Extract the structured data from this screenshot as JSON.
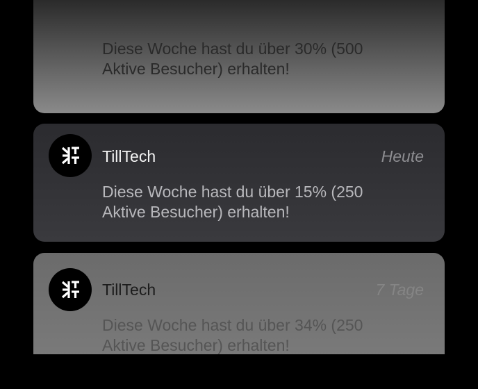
{
  "notifications": [
    {
      "message": "Diese Woche hast du über 30% (500 Aktive Besucher) erhalten!"
    },
    {
      "app": "TillTech",
      "time": "Heute",
      "message": "Diese Woche hast du über 15% (250 Aktive Besucher) erhalten!",
      "icon": "tilltech-logo-icon"
    },
    {
      "app": "TillTech",
      "time": "7 Tage",
      "message": "Diese Woche hast du über 34% (250 Aktive Besucher) erhalten!",
      "icon": "tilltech-logo-icon"
    }
  ],
  "colors": {
    "background": "#000000",
    "active_card": "#333337",
    "avatar": "#000000"
  }
}
